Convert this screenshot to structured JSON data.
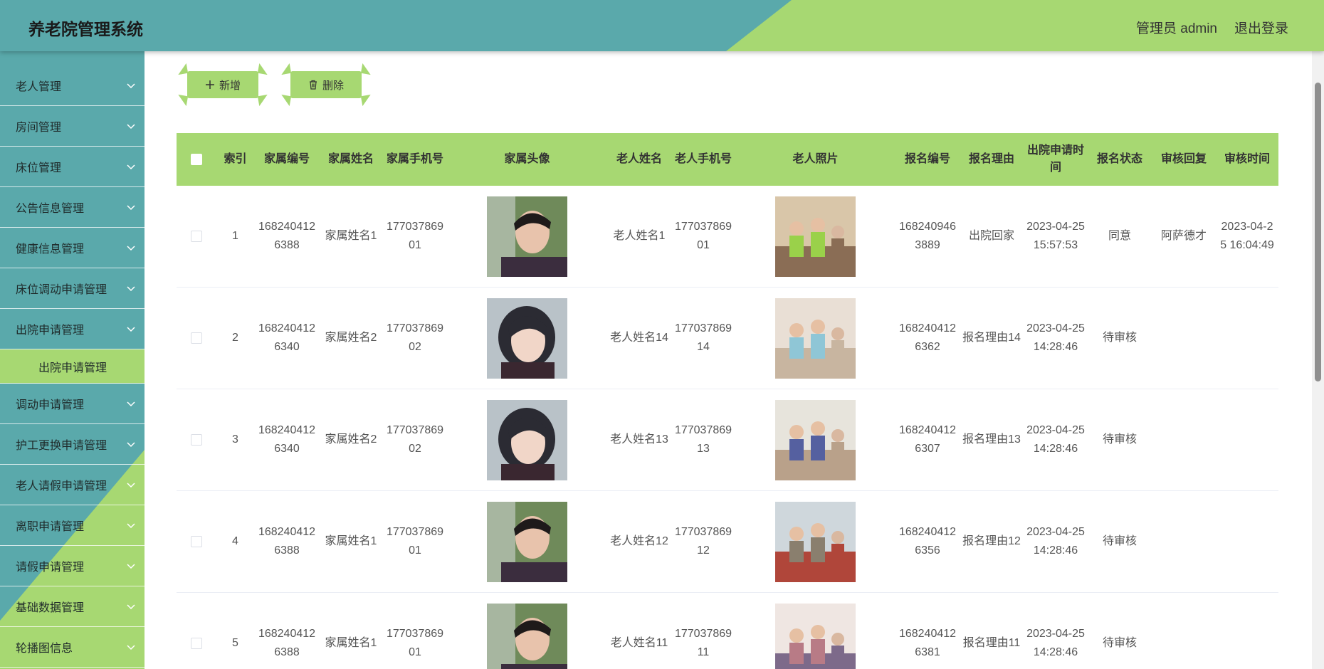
{
  "header": {
    "title": "养老院管理系统",
    "user": "管理员 admin",
    "logout": "退出登录"
  },
  "colors": {
    "teal": "#5aa9ab",
    "green": "#a7d872"
  },
  "sidebar": {
    "items": [
      {
        "label": "老人管理"
      },
      {
        "label": "房间管理"
      },
      {
        "label": "床位管理"
      },
      {
        "label": "公告信息管理"
      },
      {
        "label": "健康信息管理"
      },
      {
        "label": "床位调动申请管理"
      },
      {
        "label": "出院申请管理"
      },
      {
        "label": "调动申请管理"
      },
      {
        "label": "护工更换申请管理"
      },
      {
        "label": "老人请假申请管理"
      },
      {
        "label": "离职申请管理"
      },
      {
        "label": "请假申请管理"
      },
      {
        "label": "基础数据管理"
      },
      {
        "label": "轮播图信息"
      }
    ],
    "active_sub": "出院申请管理"
  },
  "toolbar": {
    "add_label": "新增",
    "delete_label": "删除",
    "add_icon": "plus-icon",
    "delete_icon": "trash-icon"
  },
  "table": {
    "headers": [
      "",
      "索引",
      "家属编号",
      "家属姓名",
      "家属手机号",
      "家属头像",
      "老人姓名",
      "老人手机号",
      "老人照片",
      "报名编号",
      "报名理由",
      "出院申请时间",
      "报名状态",
      "审核回复",
      "审核时间"
    ],
    "rows": [
      {
        "index": "1",
        "family_no": "1682404126388",
        "family_name": "家属姓名1",
        "family_phone": "17703786901",
        "avatar": "male",
        "elder_name": "老人姓名1",
        "elder_phone": "17703786901",
        "photo": "photo1",
        "signup_no": "1682409463889",
        "reason": "出院回家",
        "apply_time": "2023-04-25 15:57:53",
        "status": "同意",
        "reply": "阿萨德才",
        "review_time": "2023-04-25 16:04:49"
      },
      {
        "index": "2",
        "family_no": "1682404126340",
        "family_name": "家属姓名2",
        "family_phone": "17703786902",
        "avatar": "female",
        "elder_name": "老人姓名14",
        "elder_phone": "17703786914",
        "photo": "photo2",
        "signup_no": "1682404126362",
        "reason": "报名理由14",
        "apply_time": "2023-04-25 14:28:46",
        "status": "待审核",
        "reply": "",
        "review_time": ""
      },
      {
        "index": "3",
        "family_no": "1682404126340",
        "family_name": "家属姓名2",
        "family_phone": "17703786902",
        "avatar": "female",
        "elder_name": "老人姓名13",
        "elder_phone": "17703786913",
        "photo": "photo3",
        "signup_no": "1682404126307",
        "reason": "报名理由13",
        "apply_time": "2023-04-25 14:28:46",
        "status": "待审核",
        "reply": "",
        "review_time": ""
      },
      {
        "index": "4",
        "family_no": "1682404126388",
        "family_name": "家属姓名1",
        "family_phone": "17703786901",
        "avatar": "male",
        "elder_name": "老人姓名12",
        "elder_phone": "17703786912",
        "photo": "photo4",
        "signup_no": "1682404126356",
        "reason": "报名理由12",
        "apply_time": "2023-04-25 14:28:46",
        "status": "待审核",
        "reply": "",
        "review_time": ""
      },
      {
        "index": "5",
        "family_no": "1682404126388",
        "family_name": "家属姓名1",
        "family_phone": "17703786901",
        "avatar": "male",
        "elder_name": "老人姓名11",
        "elder_phone": "17703786911",
        "photo": "photo5",
        "signup_no": "1682404126381",
        "reason": "报名理由11",
        "apply_time": "2023-04-25 14:28:46",
        "status": "待审核",
        "reply": "",
        "review_time": ""
      }
    ]
  }
}
